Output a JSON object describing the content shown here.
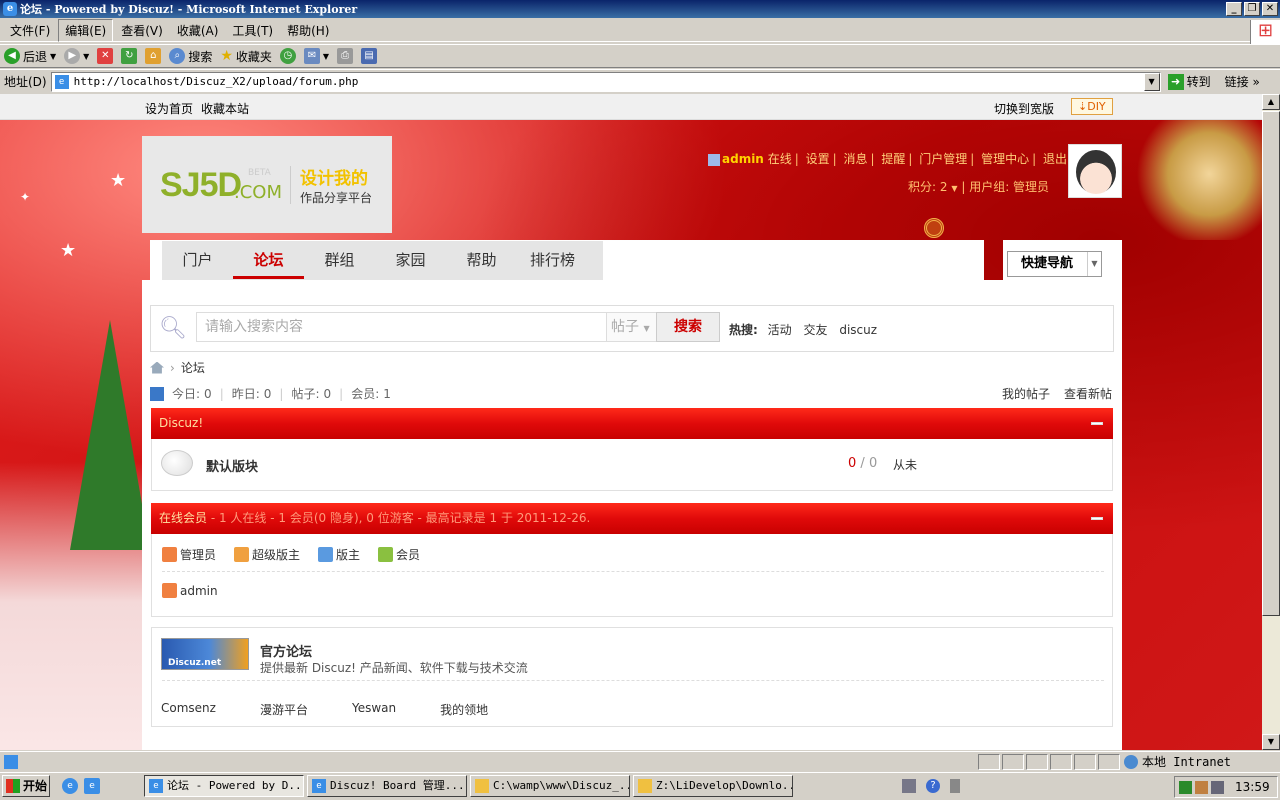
{
  "window": {
    "title": "论坛 - Powered by Discuz! - Microsoft Internet Explorer"
  },
  "menu": [
    "文件(F)",
    "编辑(E)",
    "查看(V)",
    "收藏(A)",
    "工具(T)",
    "帮助(H)"
  ],
  "toolbar": {
    "back": "后退",
    "search": "搜索",
    "favorites": "收藏夹"
  },
  "address": {
    "label": "地址(D)",
    "url": "http://localhost/Discuz_X2/upload/forum.php",
    "go": "转到",
    "links": "链接"
  },
  "topstrip": {
    "set_home": "设为首页",
    "bookmark": "收藏本站",
    "switch_width": "切换到宽版",
    "diy": "DIY"
  },
  "logo": {
    "brand": "SJ5D",
    "com": ".COM",
    "beta": "BETA",
    "slogan1": "设计我的",
    "slogan2": "作品分享平台"
  },
  "user": {
    "name": "admin",
    "online": "在线",
    "links": [
      "设置",
      "消息",
      "提醒",
      "门户管理",
      "管理中心",
      "退出"
    ],
    "credits": "积分: 2",
    "group": "用户组: 管理员"
  },
  "nav": {
    "items": [
      "门户",
      "论坛",
      "群组",
      "家园",
      "帮助",
      "排行榜"
    ],
    "active": "论坛",
    "quick": "快捷导航"
  },
  "search": {
    "placeholder": "请输入搜索内容",
    "type": "帖子",
    "button": "搜索",
    "hot_label": "热搜:",
    "hot": [
      "活动",
      "交友",
      "discuz"
    ]
  },
  "breadcrumb": {
    "current": "论坛"
  },
  "stats": {
    "today_label": "今日:",
    "today": "0",
    "yesterday_label": "昨日:",
    "yesterday": "0",
    "posts_label": "帖子:",
    "posts": "0",
    "members_label": "会员:",
    "members": "1",
    "my_posts": "我的帖子",
    "new_posts": "查看新帖"
  },
  "category": {
    "title": "Discuz!",
    "forum": {
      "name": "默认版块",
      "threads": "0",
      "sep": "/",
      "posts": "0",
      "last": "从未"
    }
  },
  "online": {
    "title": "在线会员",
    "summary": " - 1 人在线 - 1 会员(0 隐身), 0 位游客 - 最高记录是 1 于 2011-12-26.",
    "legend": [
      "管理员",
      "超级版主",
      "版主",
      "会员"
    ],
    "users": [
      "admin"
    ]
  },
  "friendlinks": {
    "logo_text": "Discuz.net",
    "official_name": "官方论坛",
    "official_desc": "提供最新 Discuz! 产品新闻、软件下载与技术交流",
    "links": [
      "Comsenz",
      "漫游平台",
      "Yeswan",
      "我的领地"
    ]
  },
  "statusbar": {
    "zone": "本地 Intranet"
  },
  "taskbar": {
    "start": "开始",
    "tasks": [
      "论坛 - Powered by D...",
      "Discuz! Board 管理...",
      "C:\\wamp\\www\\Discuz_...",
      "Z:\\LiDevelop\\Downlo..."
    ],
    "clock": "13:59"
  },
  "colors": {
    "accent": "#cc0000",
    "header_red": "#d01818",
    "link_yellow": "#ffd07a"
  }
}
